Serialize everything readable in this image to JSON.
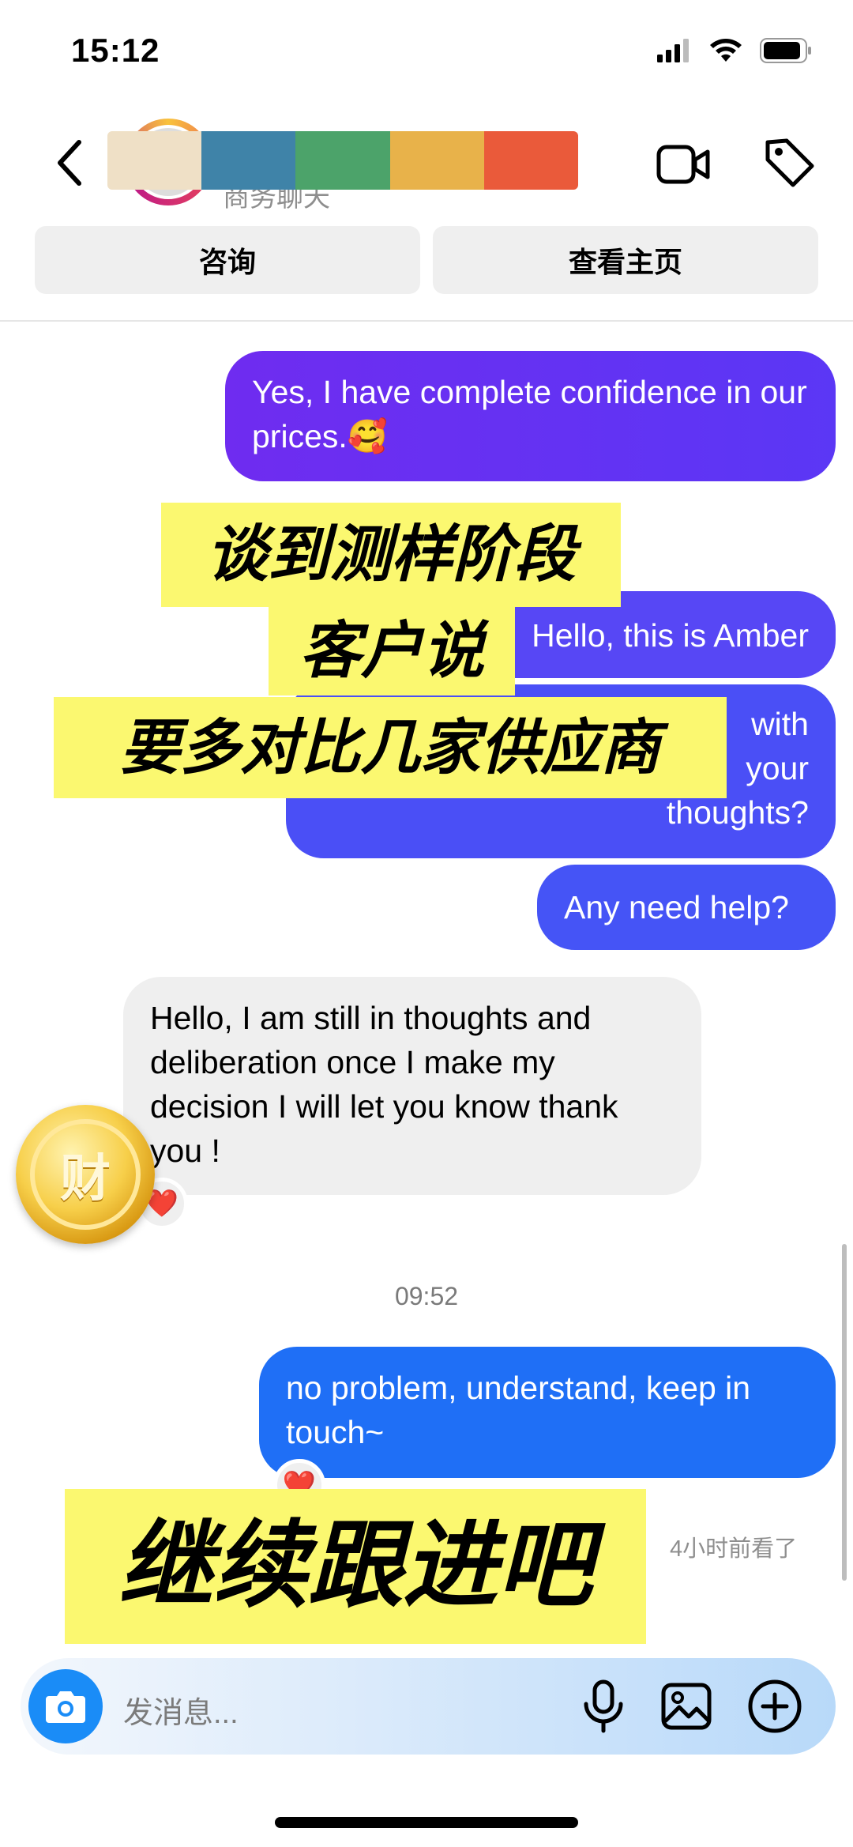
{
  "status_bar": {
    "time": "15:12",
    "battery_icon": "battery-icon",
    "wifi_icon": "wifi-icon",
    "signal_icon": "signal-icon"
  },
  "header": {
    "subtitle": "商务聊天",
    "back_icon": "chevron-left-icon",
    "video_icon": "video-call-icon",
    "tag_icon": "tag-icon",
    "tabs": [
      {
        "label": "咨询"
      },
      {
        "label": "查看主页"
      }
    ]
  },
  "messages": [
    {
      "from": "me",
      "text": "Yes, I have complete confidence in our prices.🥰"
    },
    {
      "from": "me",
      "text": "Hello, this is Amber"
    },
    {
      "from": "me",
      "text": "with\nyour\nthoughts?"
    },
    {
      "from": "me",
      "text": "Any need help?"
    },
    {
      "from": "them",
      "text": "Hello, I am still in thoughts and deliberation once I make my decision I will let you know thank you !",
      "reaction": "❤️"
    },
    {
      "from": "me",
      "text": "no problem, understand, keep in touch~",
      "reaction": "❤️"
    }
  ],
  "timestamp": "09:52",
  "seen": "4小时前看了",
  "overlays": {
    "line1": "谈到测样阶段",
    "line2": "客户说",
    "line3": "要多对比几家供应商",
    "line4": "继续跟进吧",
    "coin_char": "财"
  },
  "composer": {
    "placeholder": "发消息...",
    "camera_icon": "camera-icon",
    "mic_icon": "microphone-icon",
    "gallery_icon": "gallery-icon",
    "plus_icon": "plus-circle-icon"
  },
  "colors": {
    "accent_purple": "#6f2cf0",
    "accent_blue": "#1f6ff6",
    "highlight": "#fbf870"
  }
}
